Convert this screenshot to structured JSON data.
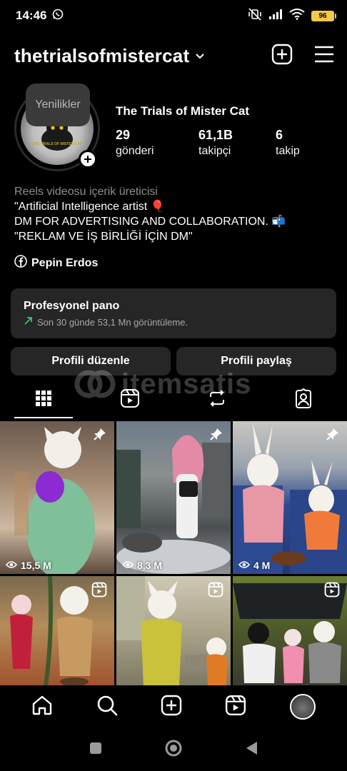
{
  "status_bar": {
    "time": "14:46",
    "battery": "96",
    "icons": [
      "whatsapp-icon",
      "mute-vibrate-icon",
      "signal-icon",
      "wifi-icon",
      "battery-icon"
    ]
  },
  "header": {
    "username": "thetrialsofmistercat",
    "icons": [
      "chevron-down-icon",
      "add-square-icon",
      "menu-icon"
    ]
  },
  "profile": {
    "tooltip": "Yenilikler",
    "display_name": "The Trials of Mister Cat",
    "avatar_text": "THE TRIALS OF MISTER CAT",
    "stats": [
      {
        "value": "29",
        "label": "gönderi"
      },
      {
        "value": "61,1B",
        "label": "takipçi"
      },
      {
        "value": "6",
        "label": "takip"
      }
    ],
    "bio": {
      "category": "Reels videosu içerik üreticisi",
      "line1": "\"Artificial Intelligence artist 🎈",
      "line2": "DM FOR ADVERTISING AND COLLABORATION. 📬",
      "line3": "\"REKLAM VE İŞ BİRLİĞİ İÇİN DM\""
    },
    "facebook_link": "Pepin Erdos"
  },
  "pro_panel": {
    "title": "Profesyonel pano",
    "subtitle": "Son 30 günde 53,1 Mn görüntüleme."
  },
  "buttons": {
    "edit": "Profili düzenle",
    "share": "Profili paylaş"
  },
  "tabs": [
    "grid-icon",
    "reels-icon",
    "reposts-icon",
    "tagged-icon"
  ],
  "watermark": "itemsatis",
  "grid": [
    {
      "views": "15,5 M",
      "badge": "pin"
    },
    {
      "views": "8,3 M",
      "badge": "pin"
    },
    {
      "views": "4 M",
      "badge": "pin"
    },
    {
      "views": "",
      "badge": "reel"
    },
    {
      "views": "",
      "badge": "reel"
    },
    {
      "views": "",
      "badge": "reel"
    }
  ],
  "colors": {
    "background": "#000000",
    "panel": "#262626",
    "secondary_text": "#a8a8a8",
    "trend_green": "#2ecc71",
    "battery": "#f2c94c"
  }
}
